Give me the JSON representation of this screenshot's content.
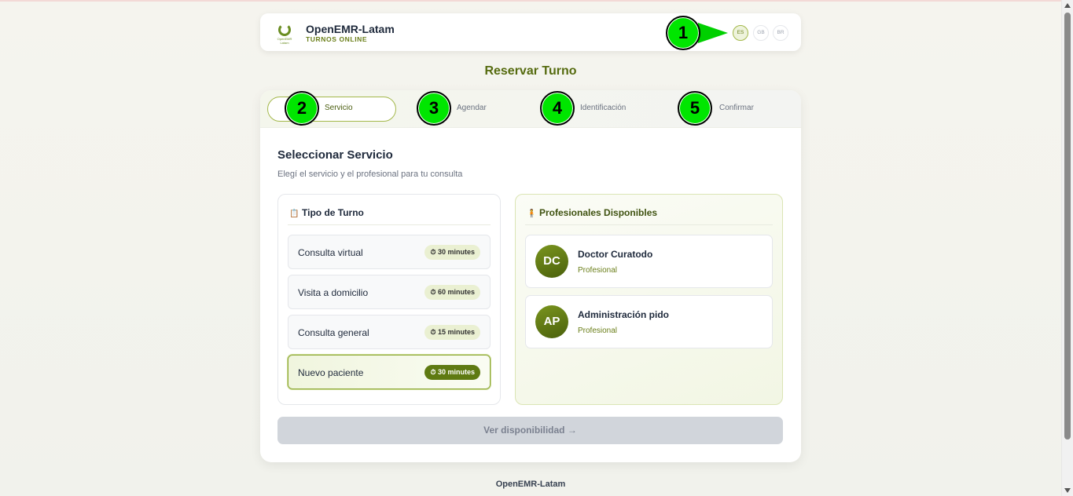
{
  "header": {
    "brand_name": "OpenEMR-Latam",
    "brand_sub": "TURNOS ONLINE",
    "logo_text": "OpenEMR Latam",
    "languages": [
      "ES",
      "GB",
      "BR"
    ]
  },
  "markers": [
    "1",
    "2",
    "3",
    "4",
    "5"
  ],
  "page_title": "Reservar Turno",
  "steps": [
    "Servicio",
    "Agendar",
    "Identificación",
    "Confirmar"
  ],
  "section": {
    "title": "Seleccionar Servicio",
    "subtitle": "Elegí el servicio y el profesional para tu consulta"
  },
  "services_panel": {
    "title": "Tipo de Turno",
    "icon": "clipboard-icon",
    "items": [
      {
        "name": "Consulta virtual",
        "duration": "⏱ 30 minutes"
      },
      {
        "name": "Visita a domicilio",
        "duration": "⏱ 60 minutes"
      },
      {
        "name": "Consulta general",
        "duration": "⏱ 15 minutes"
      },
      {
        "name": "Nuevo paciente",
        "duration": "⏱ 30 minutes"
      }
    ],
    "selected_index": 3
  },
  "professionals_panel": {
    "title": "Profesionales Disponibles",
    "icon": "person-icon",
    "items": [
      {
        "initials": "DC",
        "name": "Doctor Curatodo",
        "role": "Profesional"
      },
      {
        "initials": "AP",
        "name": "Administración pido",
        "role": "Profesional"
      }
    ]
  },
  "cta_label": "Ver disponibilidad →",
  "footer": "OpenEMR-Latam",
  "colors": {
    "accent": "#5f7a12",
    "marker": "#00e600",
    "title": "#556b0f"
  }
}
